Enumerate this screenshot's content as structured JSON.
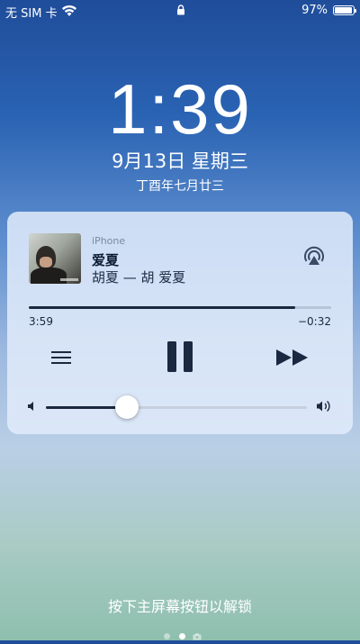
{
  "status_bar": {
    "carrier": "无 SIM 卡",
    "battery_percent": "97%",
    "battery_level": 0.97
  },
  "lock_screen": {
    "time": "1:39",
    "date": "9月13日 星期三",
    "lunar_date": "丁酉年七月廿三",
    "unlock_hint": "按下主屏幕按钮以解锁"
  },
  "now_playing": {
    "device": "iPhone",
    "title": "爱夏",
    "subtitle": "胡夏 — 胡 爱夏",
    "elapsed": "3:59",
    "remaining": "−0:32",
    "progress": 0.882,
    "volume": 0.31
  },
  "icons": [
    "wifi-icon",
    "lock-icon",
    "battery-icon",
    "airplay-icon",
    "menu-icon",
    "pause-icon",
    "fast-forward-icon",
    "volume-low-icon",
    "volume-high-icon",
    "camera-icon"
  ],
  "colors": {
    "accent": "#1a2840",
    "card_bg": "#e1ebfa"
  }
}
